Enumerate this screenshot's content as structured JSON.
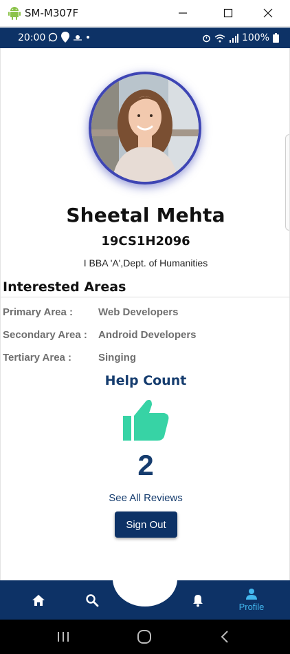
{
  "window": {
    "title": "SM-M307F",
    "icon": "android-icon",
    "controls": [
      "minimize-icon",
      "maximize-icon",
      "close-icon"
    ]
  },
  "status_bar": {
    "time": "20:00",
    "battery": "100%",
    "left_icons": [
      "whatsapp-icon",
      "swiggy-icon",
      "weather-icon",
      "dot-icon"
    ],
    "right_icons": [
      "alarm-icon",
      "wifi-icon",
      "signal-icon",
      "battery-icon"
    ]
  },
  "profile": {
    "name": "Sheetal Mehta",
    "roll_number": "19CS1H2096",
    "department": "I BBA 'A',Dept. of Humanities"
  },
  "interested_areas": {
    "title": "Interested Areas",
    "rows": [
      {
        "label": "Primary Area :",
        "value": "Web Developers"
      },
      {
        "label": "Secondary Area :",
        "value": "Android Developers"
      },
      {
        "label": "Tertiary Area :",
        "value": "Singing"
      }
    ]
  },
  "help": {
    "title": "Help Count",
    "count": "2",
    "see_all": "See All Reviews",
    "icon": "thumbs-up-icon"
  },
  "actions": {
    "sign_out": "Sign Out"
  },
  "bottom_nav": {
    "items": [
      {
        "name": "home",
        "icon": "home-icon",
        "label": ""
      },
      {
        "name": "search",
        "icon": "search-icon",
        "label": ""
      },
      {
        "name": "notifications",
        "icon": "bell-icon",
        "label": ""
      },
      {
        "name": "profile",
        "icon": "person-icon",
        "label": "Profile",
        "active": true
      }
    ]
  },
  "colors": {
    "primary": "#0d3266",
    "accent": "#43b8ef",
    "thumb": "#37d3a5",
    "avatar_ring": "#3e45b4",
    "muted_text": "#6f6f6f"
  }
}
